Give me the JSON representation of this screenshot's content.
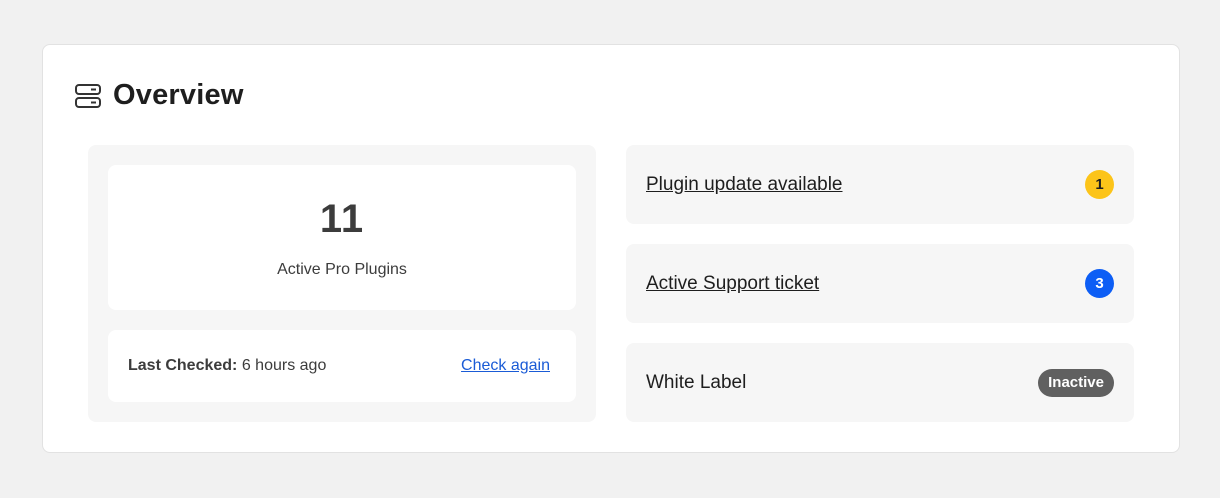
{
  "overview": {
    "title": "Overview",
    "icon": "server-icon"
  },
  "stats": {
    "active_pro_plugins_count": "11",
    "active_pro_plugins_label": "Active Pro Plugins"
  },
  "check": {
    "last_checked_label": "Last Checked:",
    "last_checked_value": "6 hours ago",
    "check_again_label": "Check again"
  },
  "status_rows": {
    "plugin_update": {
      "label": "Plugin update available",
      "count": "1",
      "badge_color": "#fcc419"
    },
    "support_ticket": {
      "label": "Active Support ticket",
      "count": "3",
      "badge_color": "#0d5ef5"
    },
    "white_label": {
      "label": "White Label",
      "status": "Inactive",
      "badge_color": "#606060"
    }
  }
}
